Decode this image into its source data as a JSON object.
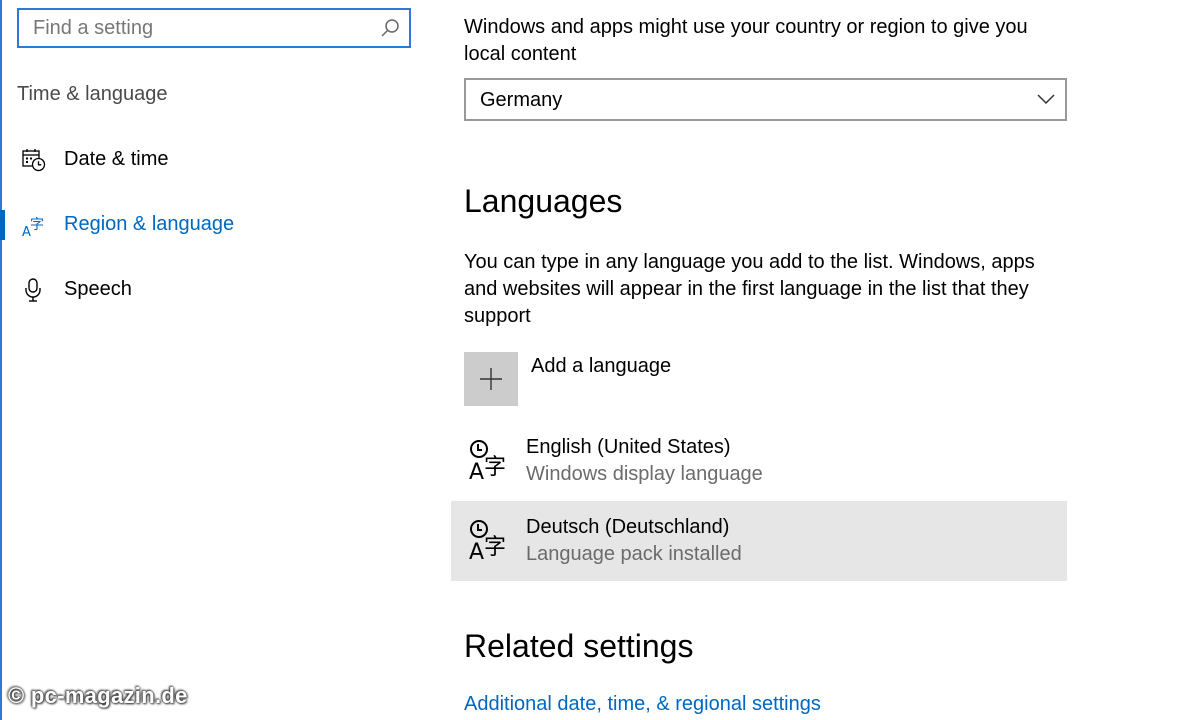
{
  "search": {
    "placeholder": "Find a setting",
    "icon": "search-icon"
  },
  "sidebar": {
    "section_title": "Time & language",
    "items": [
      {
        "label": "Date & time",
        "icon": "calendar-clock-icon",
        "selected": false
      },
      {
        "label": "Region & language",
        "icon": "language-icon",
        "selected": true
      },
      {
        "label": "Speech",
        "icon": "microphone-icon",
        "selected": false
      }
    ]
  },
  "region": {
    "description": "Windows and apps might use your country or region to give you local content",
    "selected_country": "Germany"
  },
  "languages": {
    "heading": "Languages",
    "description": "You can type in any language you add to the list. Windows, apps and websites will appear in the first language in the list that they support",
    "add_label": "Add a language",
    "items": [
      {
        "name": "English (United States)",
        "subtitle": "Windows display language",
        "highlighted": false
      },
      {
        "name": "Deutsch (Deutschland)",
        "subtitle": "Language pack installed",
        "highlighted": true
      }
    ]
  },
  "related": {
    "heading": "Related settings",
    "link_label": "Additional date, time, & regional settings"
  },
  "watermark": "© pc-magazin.de",
  "colors": {
    "accent": "#0067c0",
    "focus_border": "#2b7bd6",
    "highlight_row": "#e6e6e6",
    "add_button": "#cccccc",
    "secondary_text": "#6b6b6b"
  }
}
